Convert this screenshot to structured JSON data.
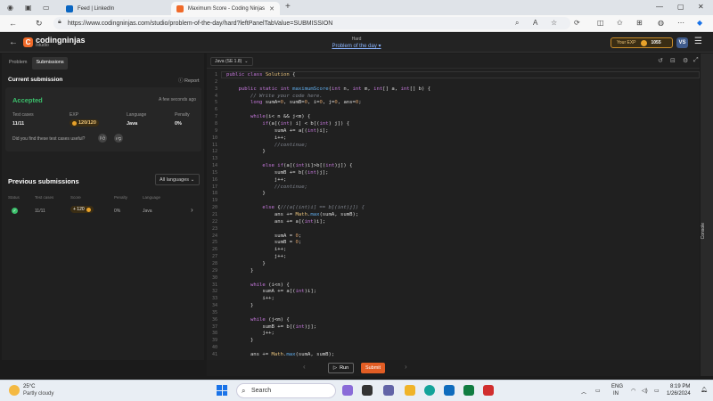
{
  "browser": {
    "tabs": [
      {
        "label": "Feed | LinkedIn",
        "active": false
      },
      {
        "label": "Maximum Score - Coding Ninjas",
        "active": true
      }
    ],
    "url": "https://www.codingninjas.com/studio/problem-of-the-day/hard?leftPanelTabValue=SUBMISSION",
    "new_tab": "+"
  },
  "header": {
    "brand": "codingninjas",
    "brand_sub": "/studio",
    "difficulty": "Hard",
    "problem_link": "Problem of the day",
    "exp_label": "Your EXP",
    "exp_value": "1055",
    "avatar": "VS"
  },
  "left": {
    "tabs": [
      "Problem",
      "Submissions"
    ],
    "current_title": "Current submission",
    "report": "Report",
    "status": "Accepted",
    "time_ago": "A few seconds ago",
    "stats": [
      {
        "label": "Test cases",
        "value": "11/11"
      },
      {
        "label": "EXP",
        "value": "120/120"
      },
      {
        "label": "Language",
        "value": "Java"
      },
      {
        "label": "Penalty",
        "value": "0%"
      }
    ],
    "feedback_q": "Did you find these test cases useful?",
    "prev_title": "Previous submissions",
    "lang_filter": "All languages",
    "table_headers": [
      "Status",
      "Test cases",
      "Score",
      "Penalty",
      "Language"
    ],
    "row": {
      "tests": "11/11",
      "score": "+ 120",
      "penalty": "0%",
      "language": "Java"
    }
  },
  "editor": {
    "language": "Java (SE 1.8)",
    "lines": [
      "public class Solution {",
      "",
      "    public static int maximumScore(int n, int m, int[] a, int[] b) {",
      "        // Write your code here.",
      "        long sumA=0, sumB=0, i=0, j=0, ans=0;",
      "",
      "        while(i< n && j<m) {",
      "            if(a[(int) i] < b[(int) j]) {",
      "                sumA += a[(int)i];",
      "                i++;",
      "                //continue;",
      "            }",
      "",
      "            else if(a[(int)i]>b[(int)j]) {",
      "                sumB += b[(int)j];",
      "                j++;",
      "                //continue;",
      "            }",
      "",
      "            else {//(a[(int)i] == b[(int)j]) {",
      "                ans += Math.max(sumA, sumB);",
      "                ans += a[(int)i];",
      "",
      "                sumA = 0;",
      "                sumB = 0;",
      "                i++;",
      "                j++;",
      "            }",
      "        }",
      "",
      "        while (i<n) {",
      "            sumA += a[(int)i];",
      "            i++;",
      "        }",
      "",
      "        while (j<m) {",
      "            sumB += b[(int)j];",
      "            j++;",
      "        }",
      "",
      "        ans += Math.max(sumA, sumB);"
    ]
  },
  "runbar": {
    "run": "Run",
    "submit": "Submit"
  },
  "console_label": "Console",
  "taskbar": {
    "temp": "25°C",
    "condition": "Partly cloudy",
    "search": "Search",
    "lang1": "ENG",
    "lang2": "IN",
    "time": "8:19 PM",
    "date": "1/26/2024"
  },
  "colors": {
    "accent": "#e25d24",
    "accepted": "#3bbf6b",
    "link": "#8ab4ff"
  }
}
